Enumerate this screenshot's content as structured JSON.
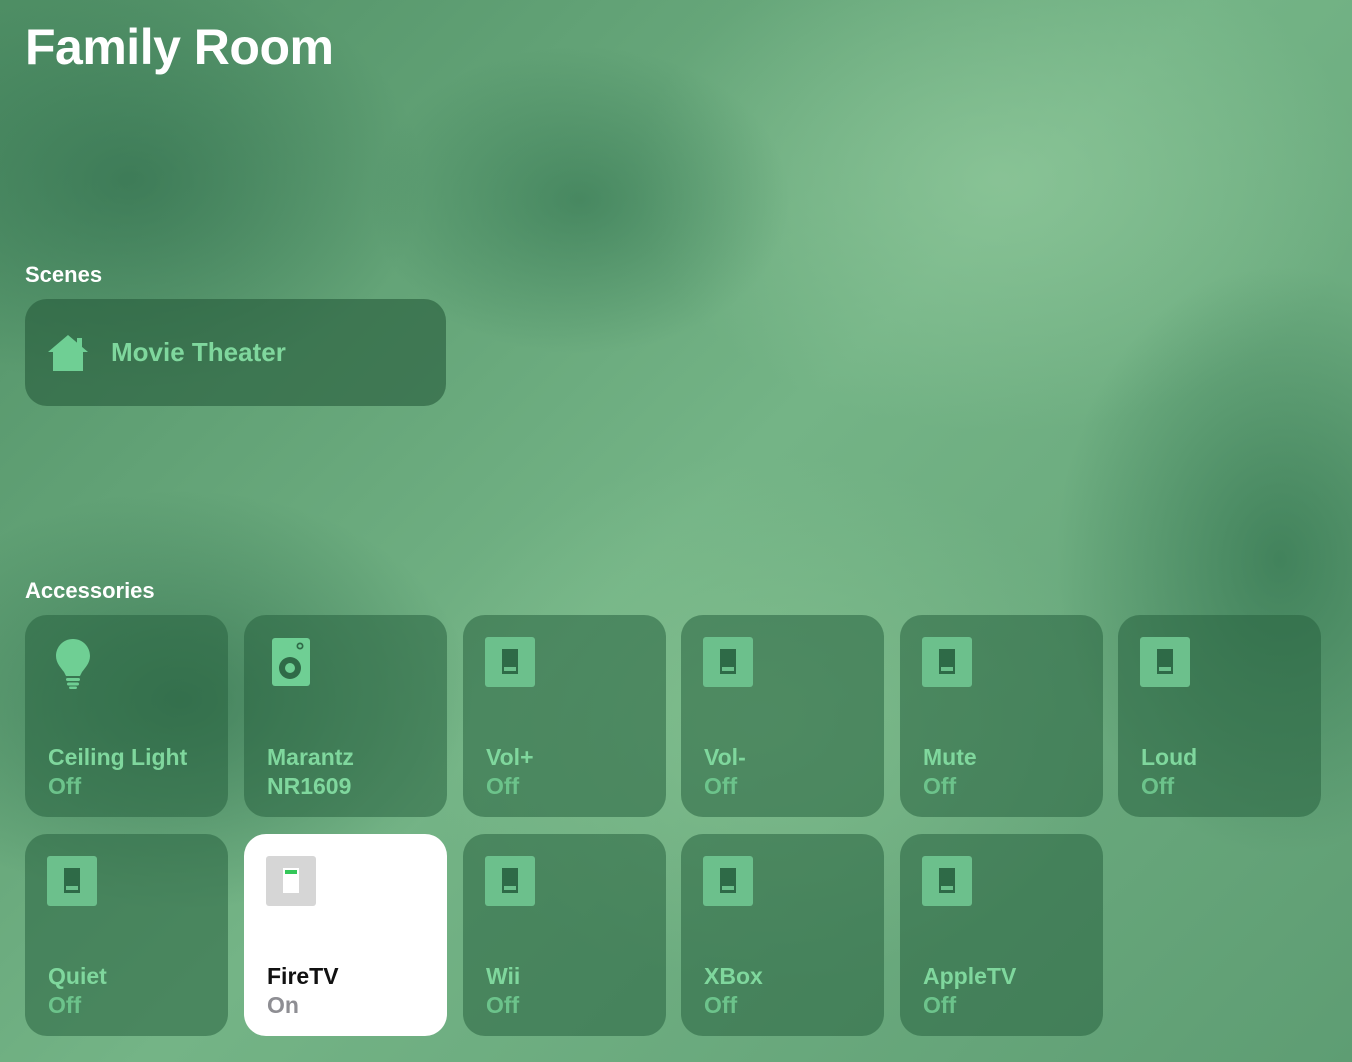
{
  "room": {
    "title": "Family Room"
  },
  "scenes": {
    "label": "Scenes",
    "items": [
      {
        "name": "Movie Theater",
        "icon": "house-icon"
      }
    ]
  },
  "accessories": {
    "label": "Accessories",
    "items": [
      {
        "name": "Ceiling Light",
        "status": "Off",
        "icon": "lightbulb-icon",
        "on": false
      },
      {
        "name": "Marantz\nNR1609",
        "status": "",
        "icon": "speaker-icon",
        "on": false
      },
      {
        "name": "Vol+",
        "status": "Off",
        "icon": "switch-icon",
        "on": false
      },
      {
        "name": "Vol-",
        "status": "Off",
        "icon": "switch-icon",
        "on": false
      },
      {
        "name": "Mute",
        "status": "Off",
        "icon": "switch-icon",
        "on": false
      },
      {
        "name": "Loud",
        "status": "Off",
        "icon": "switch-icon",
        "on": false
      },
      {
        "name": "Quiet",
        "status": "Off",
        "icon": "switch-icon",
        "on": false
      },
      {
        "name": "FireTV",
        "status": "On",
        "icon": "switch-icon",
        "on": true
      },
      {
        "name": "Wii",
        "status": "Off",
        "icon": "switch-icon",
        "on": false
      },
      {
        "name": "XBox",
        "status": "Off",
        "icon": "switch-icon",
        "on": false
      },
      {
        "name": "AppleTV",
        "status": "Off",
        "icon": "switch-icon",
        "on": false
      }
    ]
  },
  "colors": {
    "tile_label": "#7fd79d",
    "tile_on_background": "#ffffff",
    "switch_on_indicator": "#34c759"
  }
}
